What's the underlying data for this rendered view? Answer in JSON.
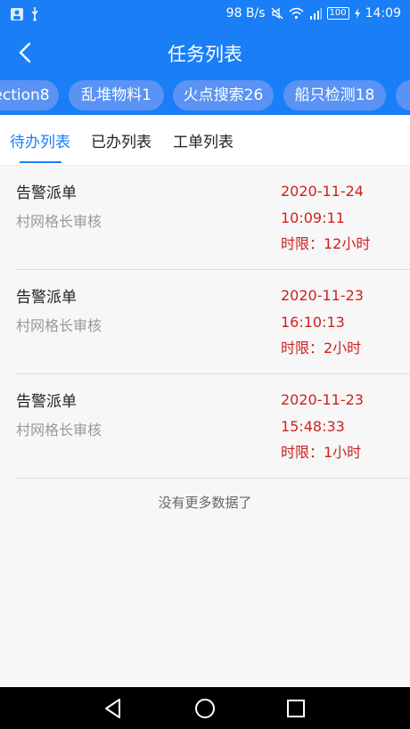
{
  "status_bar": {
    "net_speed": "98 B/s",
    "battery": "100",
    "time": "14:09"
  },
  "header": {
    "title": "任务列表"
  },
  "chips": [
    {
      "label": "ection8"
    },
    {
      "label": "乱堆物料1"
    },
    {
      "label": "火点搜索26"
    },
    {
      "label": "船只检测18"
    },
    {
      "label": ""
    }
  ],
  "tabs": [
    {
      "label": "待办列表",
      "active": true
    },
    {
      "label": "已办列表",
      "active": false
    },
    {
      "label": "工单列表",
      "active": false
    }
  ],
  "tasks": [
    {
      "title": "告警派单",
      "subtitle": "村网格长审核",
      "date": "2020-11-24",
      "time": "10:09:11",
      "deadline": "时限：12小时"
    },
    {
      "title": "告警派单",
      "subtitle": "村网格长审核",
      "date": "2020-11-23",
      "time": "16:10:13",
      "deadline": "时限：2小时"
    },
    {
      "title": "告警派单",
      "subtitle": "村网格长审核",
      "date": "2020-11-23",
      "time": "15:48:33",
      "deadline": "时限：1小时"
    }
  ],
  "footer_text": "没有更多数据了",
  "colors": {
    "primary": "#1a7ef7",
    "chip": "#5a93f4",
    "deadline": "#d01f1f"
  }
}
